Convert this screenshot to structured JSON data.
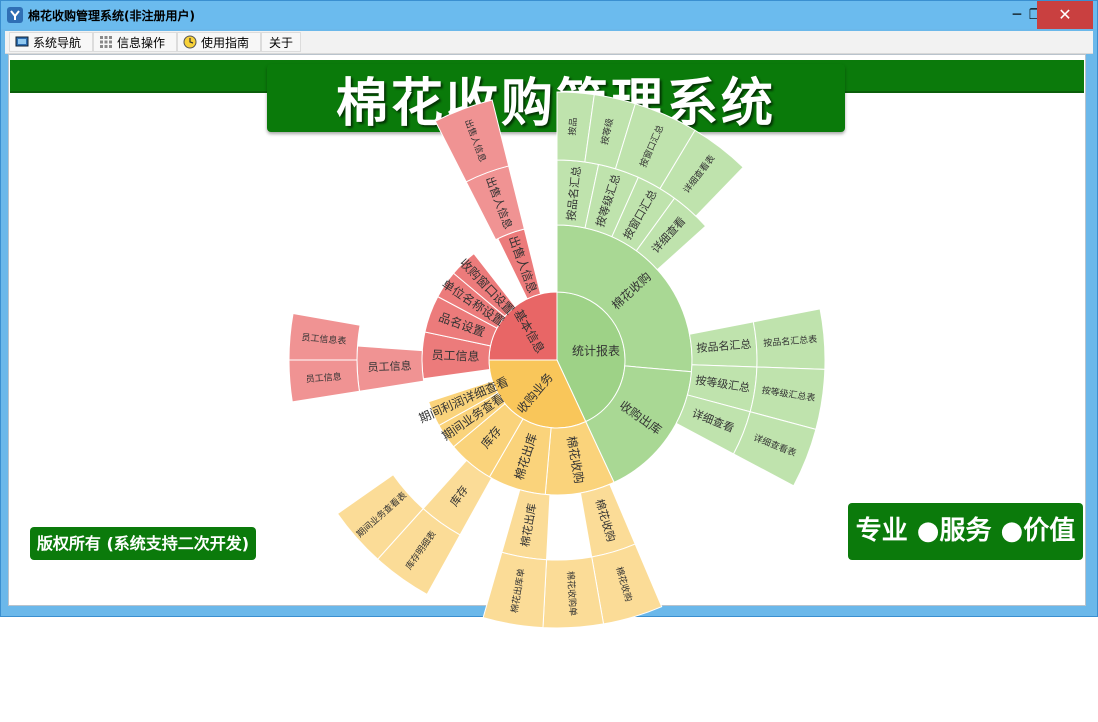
{
  "window": {
    "title": "棉花收购管理系统(非注册用户)",
    "minimize": "─",
    "maximize": "❐",
    "close": "✕"
  },
  "toolbar": {
    "nav": "系统导航",
    "info_ops": "信息操作",
    "guide": "使用指南",
    "about": "关于"
  },
  "header": {
    "title": "棉花收购管理系统"
  },
  "footer": {
    "copyright": "版权所有 (系统支持二次开发)",
    "slogan": "专业 ●服务 ●价值"
  },
  "colors": {
    "green_ring1": "#9ed287",
    "green_ring2": "#a9d894",
    "green_ring3": "#bfe3ad",
    "red_ring1": "#e86666",
    "red_ring2": "#ec7b7b",
    "red_ring3": "#f09393",
    "orange_ring1": "#f9c65a",
    "orange_ring2": "#fad37b",
    "orange_ring3": "#fbdc97",
    "banner_green": "#0b7a0b"
  },
  "sunburst": {
    "nodes": [
      {
        "id": "s1",
        "label": "统计报表",
        "ring": 1,
        "a0": 0,
        "a1": 155,
        "color": "green_ring1"
      },
      {
        "id": "s2",
        "label": "收购业务",
        "ring": 1,
        "a0": 155,
        "a1": 270,
        "color": "orange_ring1"
      },
      {
        "id": "s3",
        "label": "基本信息",
        "ring": 1,
        "a0": 270,
        "a1": 360,
        "color": "red_ring1"
      },
      {
        "id": "r2a",
        "label": "棉花收购",
        "ring": 2,
        "a0": 0,
        "a1": 95,
        "color": "green_ring2"
      },
      {
        "id": "r2b",
        "label": "收购出库",
        "ring": 2,
        "a0": 95,
        "a1": 155,
        "color": "green_ring2"
      },
      {
        "id": "r2c",
        "label": "棉花收购",
        "ring": 2,
        "a0": 155,
        "a1": 185,
        "color": "orange_ring2"
      },
      {
        "id": "r2d",
        "label": "棉花出库",
        "ring": 2,
        "a0": 185,
        "a1": 210,
        "color": "orange_ring2"
      },
      {
        "id": "r2e",
        "label": "库存",
        "ring": 2,
        "a0": 210,
        "a1": 230,
        "color": "orange_ring2"
      },
      {
        "id": "r2f",
        "label": "期间业务查看",
        "ring": 2,
        "a0": 230,
        "a1": 241,
        "color": "orange_ring2"
      },
      {
        "id": "r2g",
        "label": "期间利润详细查看",
        "ring": 2,
        "a0": 241,
        "a1": 252,
        "color": "orange_ring2"
      },
      {
        "id": "r2h",
        "label": "员工信息",
        "ring": 2,
        "a0": 262,
        "a1": 282,
        "color": "red_ring2"
      },
      {
        "id": "r2i",
        "label": "品名设置",
        "ring": 2,
        "a0": 282,
        "a1": 298,
        "color": "red_ring2"
      },
      {
        "id": "r2j",
        "label": "单位名称设置",
        "ring": 2,
        "a0": 298,
        "a1": 310,
        "color": "red_ring2"
      },
      {
        "id": "r2k",
        "label": "收购窗口设置",
        "ring": 2,
        "a0": 310,
        "a1": 322,
        "color": "red_ring2"
      },
      {
        "id": "r2l",
        "label": "出售人信息",
        "ring": 2,
        "a0": 334,
        "a1": 346,
        "color": "red_ring2"
      },
      {
        "id": "r3a",
        "label": "按品名汇总",
        "ring": 3,
        "a0": 0,
        "a1": 12,
        "color": "green_ring3"
      },
      {
        "id": "r3b",
        "label": "按等级汇总",
        "ring": 3,
        "a0": 12,
        "a1": 24,
        "color": "green_ring3"
      },
      {
        "id": "r3c",
        "label": "按窗口汇总",
        "ring": 3,
        "a0": 24,
        "a1": 36,
        "color": "green_ring3"
      },
      {
        "id": "r3d",
        "label": "详细查看",
        "ring": 3,
        "a0": 36,
        "a1": 48,
        "color": "green_ring3"
      },
      {
        "id": "r3e",
        "label": "按品名汇总",
        "ring": 3,
        "a0": 79,
        "a1": 92,
        "color": "green_ring3"
      },
      {
        "id": "r3f",
        "label": "按等级汇总",
        "ring": 3,
        "a0": 92,
        "a1": 105,
        "color": "green_ring3"
      },
      {
        "id": "r3g",
        "label": "详细查看",
        "ring": 3,
        "a0": 105,
        "a1": 118,
        "color": "green_ring3"
      },
      {
        "id": "r3h",
        "label": "棉花收购",
        "ring": 3,
        "a0": 157,
        "a1": 170,
        "color": "orange_ring3"
      },
      {
        "id": "r3i",
        "label": "棉花出库",
        "ring": 3,
        "a0": 183,
        "a1": 196,
        "color": "orange_ring3"
      },
      {
        "id": "r3j",
        "label": "库存",
        "ring": 3,
        "a0": 209,
        "a1": 222,
        "color": "orange_ring3"
      },
      {
        "id": "r3k",
        "label": "员工信息",
        "ring": 3,
        "a0": 261,
        "a1": 274,
        "color": "red_ring3"
      },
      {
        "id": "r3l",
        "label": "出售人信息",
        "ring": 3,
        "a0": 333,
        "a1": 346,
        "color": "red_ring3"
      },
      {
        "id": "r4a",
        "label": "按品",
        "ring": 4,
        "a0": 0,
        "a1": 8,
        "color": "green_ring3"
      },
      {
        "id": "r4b",
        "label": "按等级",
        "ring": 4,
        "a0": 8,
        "a1": 17,
        "color": "green_ring3"
      },
      {
        "id": "r4c",
        "label": "按窗口汇总",
        "ring": 4,
        "a0": 17,
        "a1": 31,
        "color": "green_ring3"
      },
      {
        "id": "r4d",
        "label": "详细查看表",
        "ring": 4,
        "a0": 31,
        "a1": 44,
        "color": "green_ring3"
      },
      {
        "id": "r4e",
        "label": "按品名汇总表",
        "ring": 4,
        "a0": 79,
        "a1": 92,
        "color": "green_ring3"
      },
      {
        "id": "r4f",
        "label": "按等级汇总表",
        "ring": 4,
        "a0": 92,
        "a1": 105,
        "color": "green_ring3"
      },
      {
        "id": "r4g",
        "label": "详细查看表",
        "ring": 4,
        "a0": 105,
        "a1": 118,
        "color": "green_ring3"
      },
      {
        "id": "r4h",
        "label": "棉花收购",
        "ring": 4,
        "a0": 157,
        "a1": 170,
        "color": "orange_ring3"
      },
      {
        "id": "r4i",
        "label": "棉花收购单",
        "ring": 4,
        "a0": 170,
        "a1": 183,
        "color": "orange_ring3"
      },
      {
        "id": "r4j",
        "label": "棉花出库单",
        "ring": 4,
        "a0": 183,
        "a1": 196,
        "color": "orange_ring3"
      },
      {
        "id": "r4k",
        "label": "库存明细表",
        "ring": 4,
        "a0": 209,
        "a1": 222,
        "color": "orange_ring3"
      },
      {
        "id": "r4l",
        "label": "期间业务查看表",
        "ring": 4,
        "a0": 222,
        "a1": 235,
        "color": "orange_ring3"
      },
      {
        "id": "r4m",
        "label": "员工信息",
        "ring": 4,
        "a0": 261,
        "a1": 270,
        "color": "red_ring3"
      },
      {
        "id": "r4n",
        "label": "员工信息表",
        "ring": 4,
        "a0": 270,
        "a1": 280,
        "color": "red_ring3"
      },
      {
        "id": "r4o",
        "label": "出售人信息",
        "ring": 4,
        "a0": 333,
        "a1": 346,
        "color": "red_ring3"
      }
    ]
  }
}
